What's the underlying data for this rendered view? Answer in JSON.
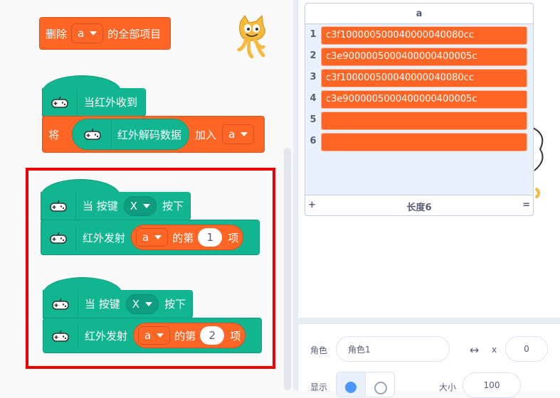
{
  "workspace": {
    "delete_all": {
      "prefix": "删除",
      "dropdown": "a",
      "suffix": "的全部项目"
    },
    "ir_receive": {
      "hat_label": "当红外收到",
      "set_prefix": "将",
      "reporter_label": "红外解码数据",
      "add_label": "加入",
      "list_dropdown": "a"
    },
    "key_block_1": {
      "when_label": "当 按键",
      "key": "X",
      "pressed_label": "按下",
      "send_label": "红外发射",
      "list_dropdown": "a",
      "item_of_label": "的第",
      "item_index": "1",
      "item_suffix": "项"
    },
    "key_block_2": {
      "when_label": "当 按键",
      "key": "X",
      "pressed_label": "按下",
      "send_label": "红外发射",
      "list_dropdown": "a",
      "item_of_label": "的第",
      "item_index": "2",
      "item_suffix": "项"
    }
  },
  "list_monitor": {
    "title": "a",
    "items": [
      {
        "index": "1",
        "value": "c3f10000050004000004008 0cc"
      },
      {
        "index": "2",
        "value": "c3e900000500040000040000 5c"
      },
      {
        "index": "3",
        "value": "c3f10000050004000004008 0cc"
      },
      {
        "index": "4",
        "value": "c3e900000500040000040000 5c"
      },
      {
        "index": "5",
        "value": ""
      },
      {
        "index": "6",
        "value": ""
      }
    ],
    "add_symbol": "+",
    "length_label": "长度6",
    "resize_symbol": "="
  },
  "sprite_info": {
    "sprite_label": "角色",
    "sprite_name": "角色1",
    "x_label": "x",
    "x_value": "0",
    "show_label": "显示",
    "size_label": "大小",
    "size_value": "100"
  },
  "colors": {
    "data_list": "#ff6626",
    "extension": "#11b590",
    "highlight": "#ee0000"
  }
}
